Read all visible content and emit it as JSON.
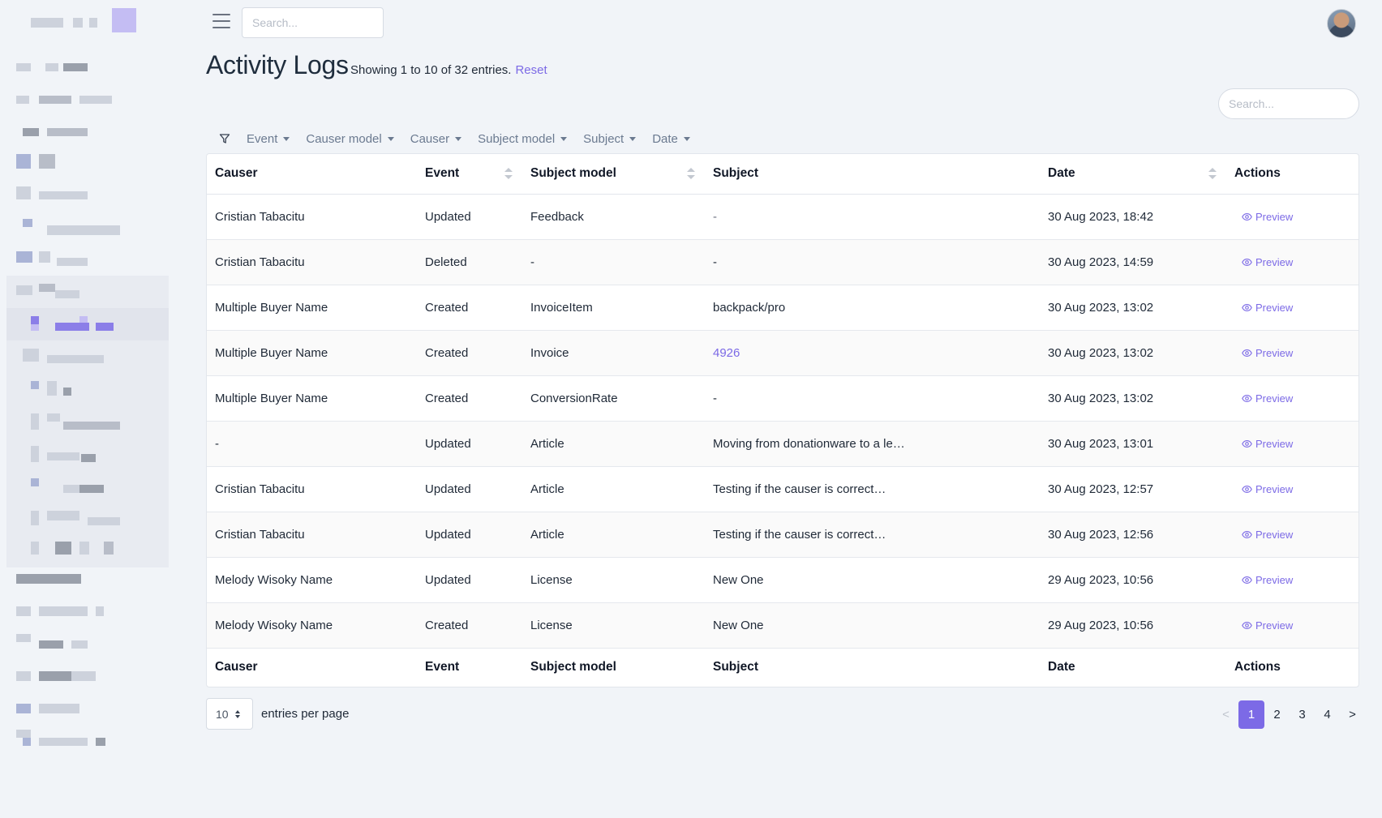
{
  "topbar": {
    "search_placeholder": "Search...",
    "menu_icon": "hamburger-icon",
    "avatar_icon": "user-avatar"
  },
  "page": {
    "title": "Activity Logs",
    "showing": "Showing 1 to 10 of 32 entries.",
    "reset": "Reset",
    "table_search_placeholder": "Search..."
  },
  "filters": {
    "icon": "filter-icon",
    "items": [
      "Event",
      "Causer model",
      "Causer",
      "Subject model",
      "Subject",
      "Date"
    ]
  },
  "table": {
    "columns": [
      "Causer",
      "Event",
      "Subject model",
      "Subject",
      "Date",
      "Actions"
    ],
    "action_label": "Preview",
    "action_icon": "eye-icon",
    "rows": [
      {
        "causer": "Cristian Tabacitu",
        "event": "Updated",
        "subject_model": "Feedback",
        "subject": "-",
        "date": "30 Aug 2023, 18:42"
      },
      {
        "causer": "Cristian Tabacitu",
        "event": "Deleted",
        "subject_model": "-",
        "subject": "-",
        "date": "30 Aug 2023, 14:59"
      },
      {
        "causer": "Multiple Buyer Name",
        "event": "Created",
        "subject_model": "InvoiceItem",
        "subject": "backpack/pro",
        "date": "30 Aug 2023, 13:02"
      },
      {
        "causer": "Multiple Buyer Name",
        "event": "Created",
        "subject_model": "Invoice",
        "subject": "4926",
        "date": "30 Aug 2023, 13:02"
      },
      {
        "causer": "Multiple Buyer Name",
        "event": "Created",
        "subject_model": "ConversionRate",
        "subject": "-",
        "date": "30 Aug 2023, 13:02"
      },
      {
        "causer": "-",
        "event": "Updated",
        "subject_model": "Article",
        "subject": "Moving from donationware to a le…",
        "date": "30 Aug 2023, 13:01"
      },
      {
        "causer": "Cristian Tabacitu",
        "event": "Updated",
        "subject_model": "Article",
        "subject": "Testing if the causer is correct…",
        "date": "30 Aug 2023, 12:57"
      },
      {
        "causer": "Cristian Tabacitu",
        "event": "Updated",
        "subject_model": "Article",
        "subject": "Testing if the causer is correct…",
        "date": "30 Aug 2023, 12:56"
      },
      {
        "causer": "Melody Wisoky Name",
        "event": "Updated",
        "subject_model": "License",
        "subject": "New One",
        "date": "29 Aug 2023, 10:56"
      },
      {
        "causer": "Melody Wisoky Name",
        "event": "Created",
        "subject_model": "License",
        "subject": "New One",
        "date": "29 Aug 2023, 10:56"
      }
    ]
  },
  "footer": {
    "per_page_value": "10",
    "per_page_label": "entries per page",
    "pagination": {
      "prev": "<",
      "pages": [
        "1",
        "2",
        "3",
        "4"
      ],
      "active_page": "1",
      "next": ">"
    }
  },
  "colors": {
    "accent": "#7c6ae6",
    "background": "#f1f4f8"
  }
}
